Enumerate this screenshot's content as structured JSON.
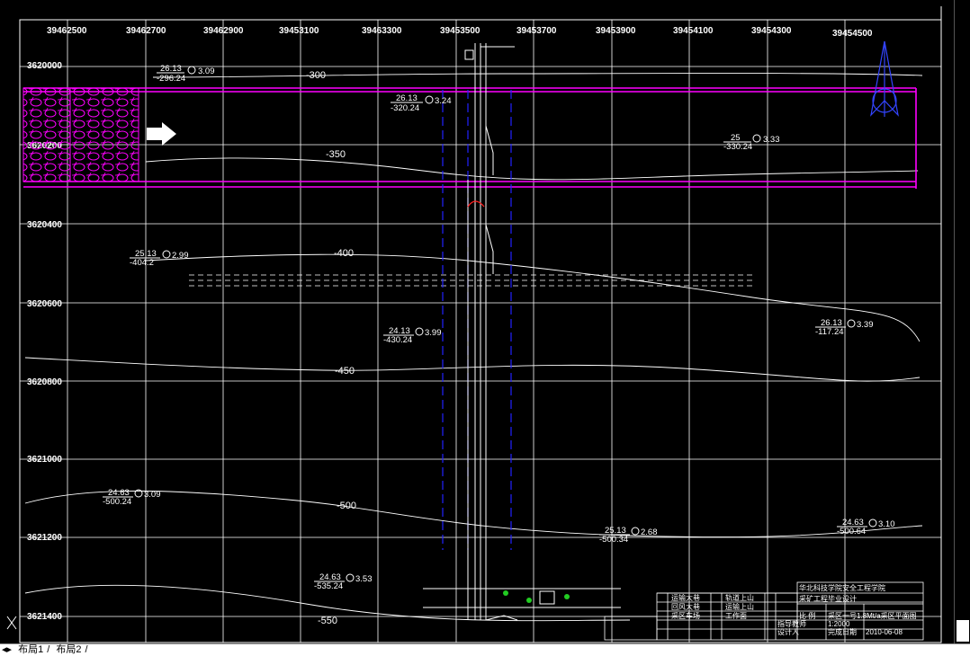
{
  "grid": {
    "x_labels": [
      "39462500",
      "39462700",
      "39462900",
      "39453100",
      "39463300",
      "39453500",
      "39453700",
      "39453900",
      "39454100",
      "39454300",
      "39454500"
    ],
    "y_labels": [
      "3620000",
      "3620200",
      "3620400",
      "3620600",
      "3620800",
      "3621000",
      "3621200",
      "3621400"
    ]
  },
  "contours": [
    {
      "label": "-300"
    },
    {
      "label": "-350"
    },
    {
      "label": "-400"
    },
    {
      "label": "-450"
    },
    {
      "label": "-500"
    },
    {
      "label": "-550"
    }
  ],
  "boreholes": [
    {
      "num": "26.13",
      "elev": "-296.24",
      "val": "3.09"
    },
    {
      "num": "26.13",
      "elev": "-320.24",
      "val": "3.24"
    },
    {
      "num": "25",
      "elev": "-330.24",
      "val": "3.33"
    },
    {
      "num": "25.13",
      "elev": "-404.2",
      "val": "2.99"
    },
    {
      "num": "26.13",
      "elev": "-117.24",
      "val": "3.39"
    },
    {
      "num": "24.13",
      "elev": "-430.24",
      "val": "3.99"
    },
    {
      "num": "24.63",
      "elev": "-500.24",
      "val": "3.09"
    },
    {
      "num": "25.13",
      "elev": "-500.34",
      "val": "2.68"
    },
    {
      "num": "24.63",
      "elev": "-500.64",
      "val": "3.10"
    },
    {
      "num": "24.63",
      "elev": "-535.24",
      "val": "3.53"
    }
  ],
  "title_block": {
    "school": "华北科技学院安全工程学院",
    "subtitle": "采矿工程毕业设计",
    "drawing": "采区一号1.8Mt/a采区平面图",
    "scale_label": "比 例",
    "scale": "1:2000",
    "designer": "设计人",
    "date_label": "完成日期",
    "date": "2010-06-08",
    "checker": "指导教师"
  },
  "legend_rows": [
    "运输大巷",
    "回风大巷",
    "采区车场",
    "轨道上山",
    "运输上山",
    "工作面"
  ],
  "layout_tabs": {
    "tab1": "布局1",
    "tab2": "布局2"
  },
  "colors": {
    "grid": "#ffffff",
    "bar": "#ff00ff",
    "fault": "#2222ff",
    "background": "#000000"
  }
}
